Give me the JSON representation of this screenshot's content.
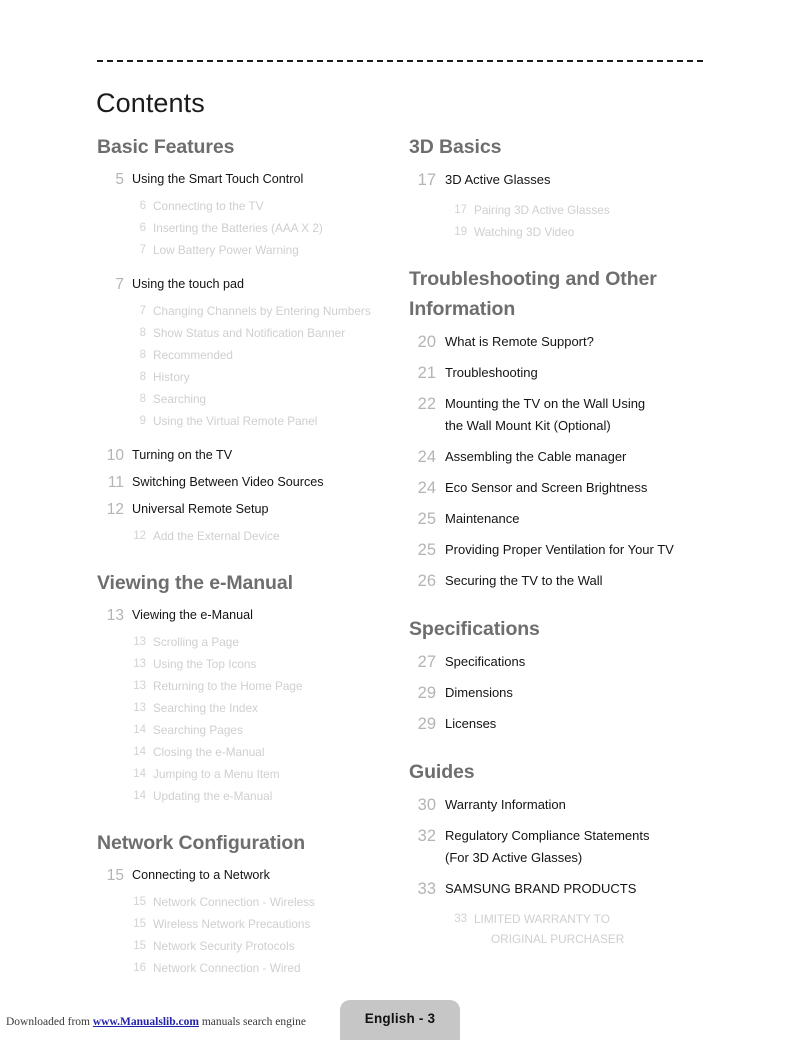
{
  "page": {
    "title": "Contents",
    "language_badge": "English - 3"
  },
  "footer": {
    "prefix": "Downloaded from ",
    "link": "www.Manualslib.com",
    "suffix": " manuals search engine"
  },
  "colors": {
    "heading": "#6e6e6e",
    "entry_text": "#141414",
    "entry_page": "#b4b4b4",
    "sub_text": "#cfcfcf",
    "sub_page": "#d2d2d2",
    "badge_bg": "#c6c6c6",
    "link": "#2222aa"
  },
  "left_column": [
    {
      "heading": "Basic Features",
      "entries": [
        {
          "page": "5",
          "title": "Using the Smart Touch Control",
          "subs": [
            {
              "page": "6",
              "title": "Connecting to the TV"
            },
            {
              "page": "6",
              "title": "Inserting the Batteries (AAA X 2)"
            },
            {
              "page": "7",
              "title": "Low Battery Power Warning"
            }
          ]
        },
        {
          "page": "7",
          "title": "Using the touch pad",
          "subs": [
            {
              "page": "7",
              "title": "Changing Channels by Entering Numbers"
            },
            {
              "page": "8",
              "title": "Show Status and Notification Banner"
            },
            {
              "page": "8",
              "title": "Recommended"
            },
            {
              "page": "8",
              "title": "History"
            },
            {
              "page": "8",
              "title": "Searching"
            },
            {
              "page": "9",
              "title": "Using the Virtual Remote Panel"
            }
          ]
        },
        {
          "page": "10",
          "title": "Turning on the TV",
          "subs": []
        },
        {
          "page": "11",
          "title": "Switching Between Video Sources",
          "subs": []
        },
        {
          "page": "12",
          "title": "Universal Remote Setup",
          "subs": [
            {
              "page": "12",
              "title": "Add the External Device"
            }
          ]
        }
      ]
    },
    {
      "heading": "Viewing the e-Manual",
      "entries": [
        {
          "page": "13",
          "title": "Viewing the e-Manual",
          "subs": [
            {
              "page": "13",
              "title": "Scrolling a Page"
            },
            {
              "page": "13",
              "title": "Using the Top Icons"
            },
            {
              "page": "13",
              "title": "Returning to the Home Page"
            },
            {
              "page": "13",
              "title": "Searching the Index"
            },
            {
              "page": "14",
              "title": "Searching Pages"
            },
            {
              "page": "14",
              "title": "Closing the e-Manual"
            },
            {
              "page": "14",
              "title": "Jumping to a Menu Item"
            },
            {
              "page": "14",
              "title": "Updating the e-Manual"
            }
          ]
        }
      ]
    },
    {
      "heading": "Network Configuration",
      "entries": [
        {
          "page": "15",
          "title": "Connecting to a Network",
          "subs": [
            {
              "page": "15",
              "title": "Network Connection - Wireless"
            },
            {
              "page": "15",
              "title": "Wireless Network Precautions"
            },
            {
              "page": "15",
              "title": "Network Security Protocols"
            },
            {
              "page": "16",
              "title": "Network Connection - Wired"
            }
          ]
        }
      ]
    }
  ],
  "right_column": [
    {
      "heading": "3D Basics",
      "entries": [
        {
          "page": "17",
          "title": "3D Active Glasses",
          "subs": [
            {
              "page": "17",
              "title": "Pairing 3D Active Glasses"
            },
            {
              "page": "19",
              "title": "Watching 3D Video"
            }
          ]
        }
      ]
    },
    {
      "heading": "Troubleshooting and Other Information",
      "entries": [
        {
          "page": "20",
          "title": "What is Remote Support?",
          "subs": []
        },
        {
          "page": "21",
          "title": "Troubleshooting",
          "subs": []
        },
        {
          "page": "22",
          "title": "Mounting the TV on the Wall Using",
          "title_cont": "the Wall Mount Kit (Optional)",
          "subs": []
        },
        {
          "page": "24",
          "title": "Assembling the Cable manager",
          "subs": []
        },
        {
          "page": "24",
          "title": "Eco Sensor and Screen Brightness",
          "subs": []
        },
        {
          "page": "25",
          "title": "Maintenance",
          "subs": []
        },
        {
          "page": "25",
          "title": "Providing Proper Ventilation for Your TV",
          "subs": []
        },
        {
          "page": "26",
          "title": "Securing the TV to the Wall",
          "subs": []
        }
      ]
    },
    {
      "heading": "Specifications",
      "entries": [
        {
          "page": "27",
          "title": "Specifications",
          "subs": []
        },
        {
          "page": "29",
          "title": "Dimensions",
          "subs": []
        },
        {
          "page": "29",
          "title": "Licenses",
          "subs": []
        }
      ]
    },
    {
      "heading": "Guides",
      "entries": [
        {
          "page": "30",
          "title": "Warranty Information",
          "subs": []
        },
        {
          "page": "32",
          "title": "Regulatory Compliance Statements",
          "title_cont": "(For 3D Active Glasses)",
          "subs": []
        },
        {
          "page": "33",
          "title": "SAMSUNG BRAND PRODUCTS",
          "subs": [
            {
              "page": "33",
              "title": "LIMITED WARRANTY TO",
              "title_cont": "ORIGINAL PURCHASER"
            }
          ]
        }
      ]
    }
  ]
}
